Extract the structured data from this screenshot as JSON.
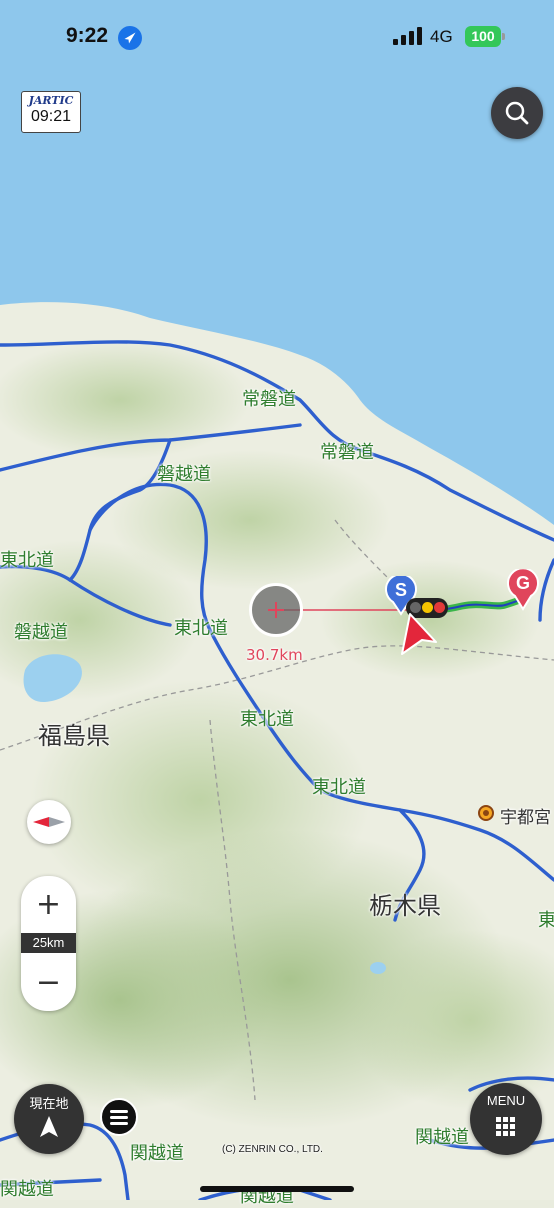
{
  "status_bar": {
    "time": "9:22",
    "carrier": "4G",
    "battery": "100"
  },
  "traffic_info": {
    "brand": "JARTIC",
    "time": "09:21"
  },
  "map": {
    "road_labels": [
      "常磐道",
      "常磐道",
      "磐越道",
      "東北道",
      "磐越道",
      "東北道",
      "東北道",
      "東北道",
      "関越道",
      "関越道",
      "関越道",
      "関越道",
      "東"
    ],
    "prefecture_labels": [
      "福島県",
      "栃木県"
    ],
    "city_labels": [
      "宇都宮"
    ],
    "distance": "30.7km",
    "start_marker": "S",
    "goal_marker": "G",
    "copyright": "(C) ZENRIN CO., LTD."
  },
  "controls": {
    "zoom_scale": "25km",
    "current_location_label": "現在地",
    "menu_label": "MENU"
  }
}
